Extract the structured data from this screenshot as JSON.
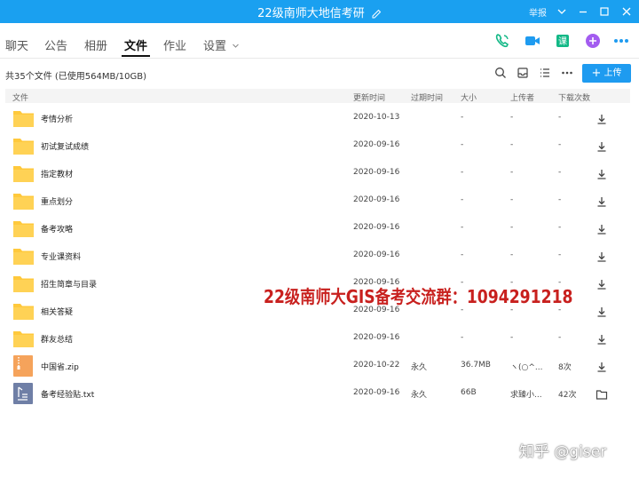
{
  "window": {
    "title": "22级南师大地信考研",
    "report_label": "举报"
  },
  "tabs": [
    {
      "label": "聊天",
      "active": false
    },
    {
      "label": "公告",
      "active": false
    },
    {
      "label": "相册",
      "active": false
    },
    {
      "label": "文件",
      "active": true
    },
    {
      "label": "作业",
      "active": false
    },
    {
      "label": "设置",
      "active": false
    }
  ],
  "header_icons": [
    "phone-icon",
    "video-icon",
    "class-icon",
    "add-app-icon",
    "more-icon"
  ],
  "files_summary": "共35个文件 (已使用564MB/10GB)",
  "upload_label": "上传",
  "columns": [
    "文件",
    "更新时间",
    "过期时间",
    "大小",
    "上传者",
    "下载次数"
  ],
  "files": [
    {
      "name": "考情分析",
      "type": "folder",
      "updated": "2020-10-13",
      "expires": "",
      "size": "-",
      "uploader": "-",
      "downloads": "-",
      "action": "download-icon"
    },
    {
      "name": "初试复试成绩",
      "type": "folder",
      "updated": "2020-09-16",
      "expires": "",
      "size": "-",
      "uploader": "-",
      "downloads": "-",
      "action": "download-icon"
    },
    {
      "name": "指定教材",
      "type": "folder",
      "updated": "2020-09-16",
      "expires": "",
      "size": "-",
      "uploader": "-",
      "downloads": "-",
      "action": "download-icon"
    },
    {
      "name": "重点划分",
      "type": "folder",
      "updated": "2020-09-16",
      "expires": "",
      "size": "-",
      "uploader": "-",
      "downloads": "-",
      "action": "download-icon"
    },
    {
      "name": "备考攻略",
      "type": "folder",
      "updated": "2020-09-16",
      "expires": "",
      "size": "-",
      "uploader": "-",
      "downloads": "-",
      "action": "download-icon"
    },
    {
      "name": "专业课资料",
      "type": "folder",
      "updated": "2020-09-16",
      "expires": "",
      "size": "-",
      "uploader": "-",
      "downloads": "-",
      "action": "download-icon"
    },
    {
      "name": "招生简章与目录",
      "type": "folder",
      "updated": "2020-09-16",
      "expires": "",
      "size": "-",
      "uploader": "-",
      "downloads": "-",
      "action": "download-icon"
    },
    {
      "name": "相关答疑",
      "type": "folder",
      "updated": "2020-09-16",
      "expires": "",
      "size": "-",
      "uploader": "-",
      "downloads": "-",
      "action": "download-icon"
    },
    {
      "name": "群友总结",
      "type": "folder",
      "updated": "2020-09-16",
      "expires": "",
      "size": "-",
      "uploader": "-",
      "downloads": "-",
      "action": "download-icon"
    },
    {
      "name": "中国省.zip",
      "type": "zip",
      "updated": "2020-10-22",
      "expires": "永久",
      "size": "36.7MB",
      "uploader": "ヽ(○^...",
      "downloads": "8次",
      "action": "download-icon"
    },
    {
      "name": "备考经验贴.txt",
      "type": "txt",
      "updated": "2020-09-16",
      "expires": "永久",
      "size": "66B",
      "uploader": "求臻小...",
      "downloads": "42次",
      "action": "open-folder-icon"
    }
  ],
  "watermark_text": "22级南师大GIS备考交流群：1094291218",
  "zhihu_watermark": "知乎 @giser",
  "colors": {
    "titlebar": "#1aa0f0",
    "accent": "#1e9bf0",
    "folder": "#ffc93c",
    "watermark": "#c8201e"
  }
}
